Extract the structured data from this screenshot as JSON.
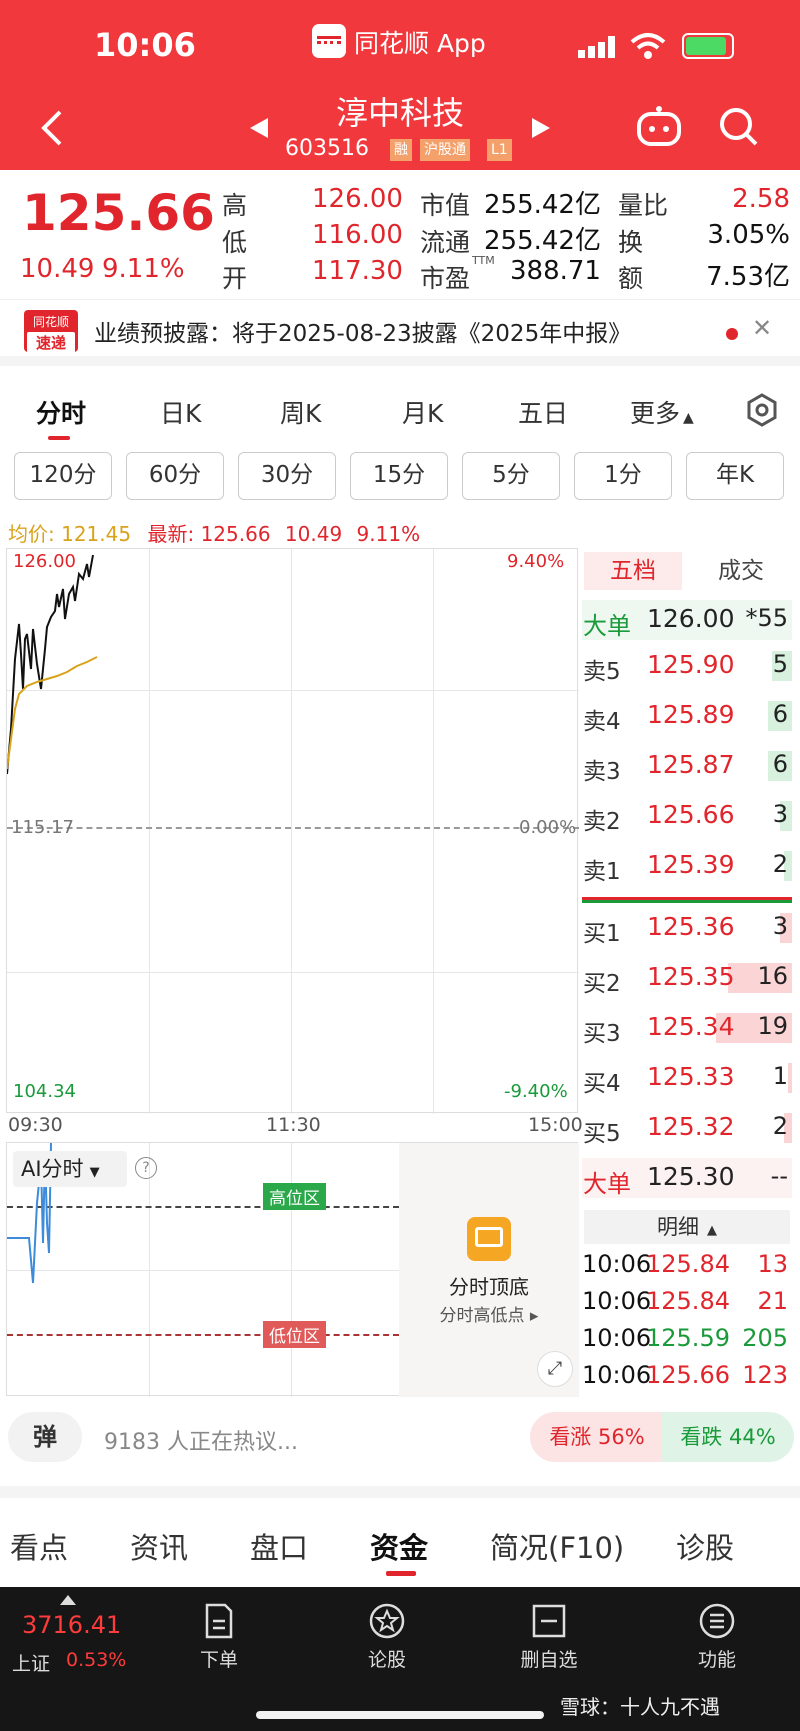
{
  "status_bar": {
    "time": "10:06",
    "app": "同花顺 App"
  },
  "header": {
    "name": "淳中科技",
    "code": "603516",
    "tags": [
      "融",
      "沪股通",
      "L1"
    ]
  },
  "quote": {
    "price": "125.66",
    "change": "10.49",
    "pct": "9.11%",
    "fields": [
      {
        "l": "高",
        "v": "126.00"
      },
      {
        "l": "低",
        "v": "116.00"
      },
      {
        "l": "开",
        "v": "117.30"
      },
      {
        "l": "市值",
        "v": "255.42亿"
      },
      {
        "l": "流通",
        "v": "255.42亿"
      },
      {
        "l": "市盈",
        "sup": "TTM",
        "v": "388.71"
      },
      {
        "l": "量比",
        "v": "2.58"
      },
      {
        "l": "换",
        "v": "3.05%"
      },
      {
        "l": "额",
        "v": "7.53亿"
      }
    ]
  },
  "notice": {
    "logo1": "同花顺",
    "logo2": "速递",
    "text": "业绩预披露：将于2025-08-23披露《2025年中报》"
  },
  "tabs": [
    "分时",
    "日K",
    "周K",
    "月K",
    "五日",
    "更多"
  ],
  "periods": [
    "120分",
    "60分",
    "30分",
    "15分",
    "5分",
    "1分",
    "年K"
  ],
  "info_line": {
    "avg_label": "均价:",
    "avg": "121.45",
    "last_label": "最新:",
    "last": "125.66",
    "change": "10.49",
    "pct": "9.11%"
  },
  "chart": {
    "y_top": "126.00",
    "y_mid": "115.17",
    "y_bot": "104.34",
    "pct_top": "9.40%",
    "pct_mid": "0.00%",
    "pct_bot": "-9.40%",
    "times": [
      "09:30",
      "11:30",
      "15:00"
    ]
  },
  "ai": {
    "label": "AI分时",
    "high_zone": "高位区",
    "low_zone": "低位区",
    "promo_title": "分时顶底",
    "promo_sub": "分时高低点"
  },
  "orderbook": {
    "tab1": "五档",
    "tab2": "成交",
    "big_top": {
      "l": "大单",
      "p": "126.00",
      "v": "*55"
    },
    "asks": [
      {
        "l": "卖5",
        "p": "125.90",
        "v": "5",
        "w": 20
      },
      {
        "l": "卖4",
        "p": "125.89",
        "v": "6",
        "w": 24
      },
      {
        "l": "卖3",
        "p": "125.87",
        "v": "6",
        "w": 24
      },
      {
        "l": "卖2",
        "p": "125.66",
        "v": "3",
        "w": 12
      },
      {
        "l": "卖1",
        "p": "125.39",
        "v": "2",
        "w": 8
      }
    ],
    "bids": [
      {
        "l": "买1",
        "p": "125.36",
        "v": "3",
        "w": 12
      },
      {
        "l": "买2",
        "p": "125.35",
        "v": "16",
        "w": 64
      },
      {
        "l": "买3",
        "p": "125.34",
        "v": "19",
        "w": 76
      },
      {
        "l": "买4",
        "p": "125.33",
        "v": "1",
        "w": 4
      },
      {
        "l": "买5",
        "p": "125.32",
        "v": "2",
        "w": 8
      }
    ],
    "big_bot": {
      "l": "大单",
      "p": "125.30",
      "v": "--"
    },
    "detail_label": "明细",
    "details": [
      {
        "t": "10:06",
        "p": "125.84",
        "v": "13",
        "c": "red"
      },
      {
        "t": "10:06",
        "p": "125.84",
        "v": "21",
        "c": "red"
      },
      {
        "t": "10:06",
        "p": "125.59",
        "v": "205",
        "c": "green"
      },
      {
        "t": "10:06",
        "p": "125.66",
        "v": "123",
        "c": "red"
      }
    ]
  },
  "discuss": {
    "btn": "弹",
    "text": "9183 人正在热议...",
    "bull": "看涨 56%",
    "bear": "看跌 44%"
  },
  "bottom_tabs": [
    "看点",
    "资讯",
    "盘口",
    "资金",
    "简况(F10)",
    "诊股"
  ],
  "index": {
    "value": "3716.41",
    "name": "上证",
    "pct": "0.53%"
  },
  "nav": [
    "下单",
    "论股",
    "删自选",
    "功能"
  ],
  "watermark": "雪球：十人九不遇",
  "colors": {
    "red": "#e0262c",
    "green": "#1a9a3a",
    "header": "#f0383d"
  }
}
